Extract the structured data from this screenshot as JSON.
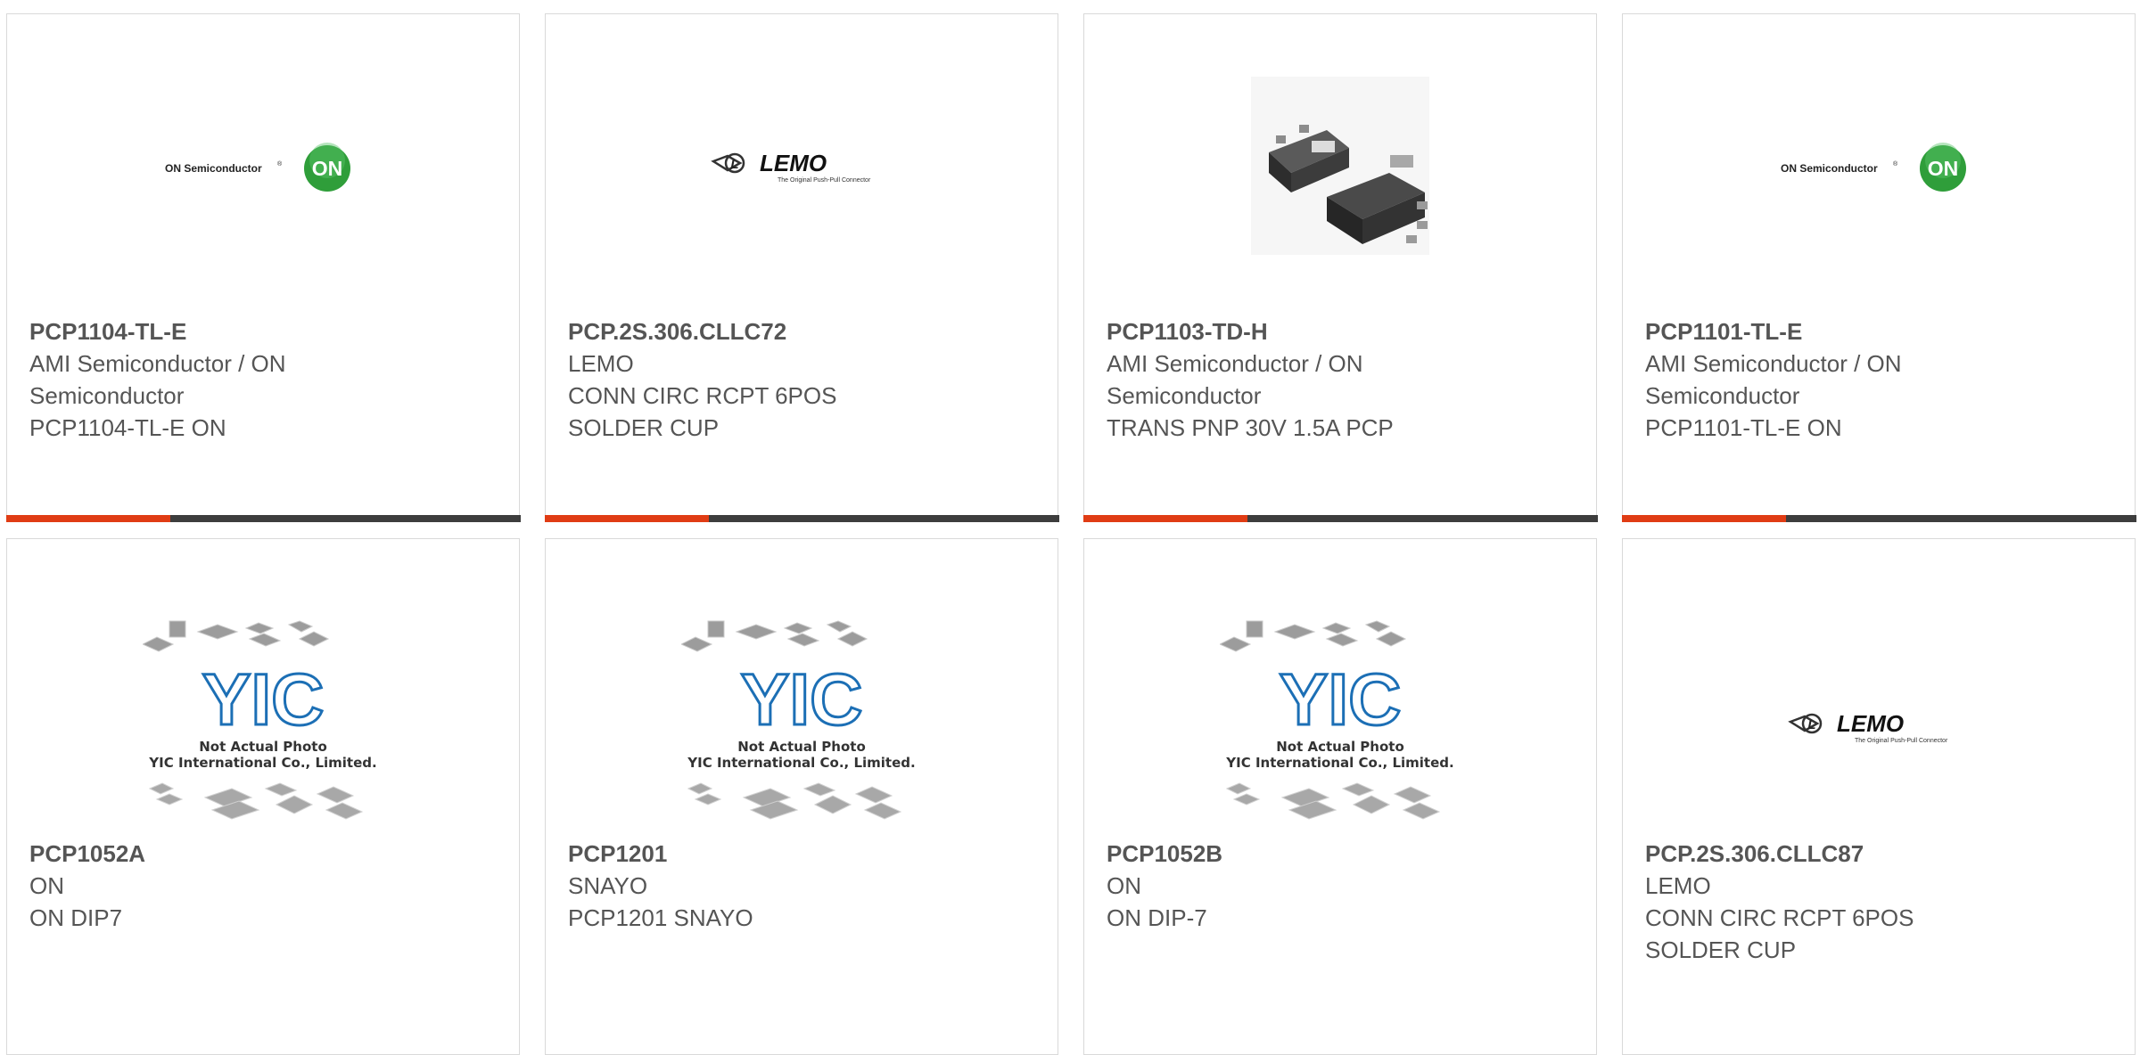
{
  "products": [
    {
      "part": "PCP1104-TL-E",
      "lines": [
        "AMI Semiconductor / ON",
        "Semiconductor",
        "PCP1104-TL-E ON"
      ],
      "image": "on-semiconductor-logo"
    },
    {
      "part": "PCP.2S.306.CLLC72",
      "lines": [
        "LEMO",
        "CONN CIRC RCPT 6POS",
        "SOLDER CUP"
      ],
      "image": "lemo-logo"
    },
    {
      "part": "PCP1103-TD-H",
      "lines": [
        "AMI Semiconductor / ON",
        "Semiconductor",
        "TRANS PNP 30V 1.5A PCP"
      ],
      "image": "transistor-package-photo"
    },
    {
      "part": "PCP1101-TL-E",
      "lines": [
        "AMI Semiconductor / ON",
        "Semiconductor",
        "PCP1101-TL-E ON"
      ],
      "image": "on-semiconductor-logo"
    },
    {
      "part": "PCP1052A",
      "lines": [
        "ON",
        "ON DIP7"
      ],
      "image": "yic-placeholder"
    },
    {
      "part": "PCP1201",
      "lines": [
        "SNAYO",
        "PCP1201 SNAYO"
      ],
      "image": "yic-placeholder"
    },
    {
      "part": "PCP1052B",
      "lines": [
        "ON",
        "ON DIP-7"
      ],
      "image": "yic-placeholder"
    },
    {
      "part": "PCP.2S.306.CLLC87",
      "lines": [
        "LEMO",
        "CONN CIRC RCPT 6POS",
        "SOLDER CUP"
      ],
      "image": "lemo-logo"
    }
  ],
  "logos": {
    "on": {
      "brand_text": "ON Semiconductor",
      "badge_text": "ON",
      "registered_mark": "®"
    },
    "lemo": {
      "brand_text": "LEMO",
      "tagline": "The Original Push-Pull Connector"
    },
    "yic": {
      "brand_text": "YIC",
      "caption1": "Not Actual Photo",
      "caption2": "YIC International Co., Limited."
    }
  },
  "colors": {
    "accent": "#e03c14",
    "bar_dark": "#3d3d3d",
    "border": "#d9d9d9",
    "text": "#555555",
    "on_green": "#2f9e3a",
    "yic_blue": "#1c6fb5"
  }
}
